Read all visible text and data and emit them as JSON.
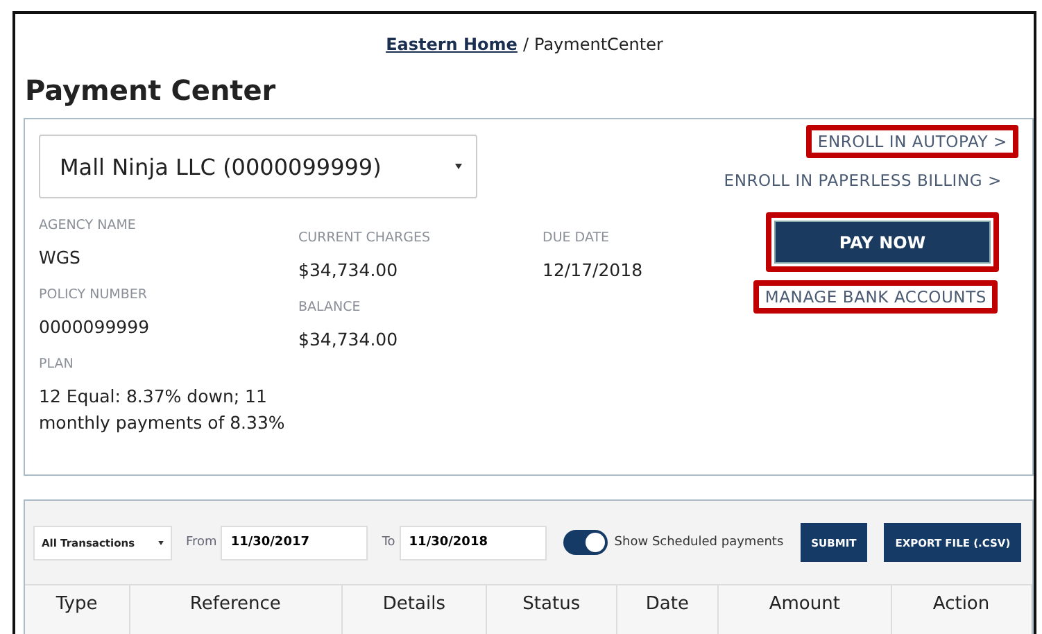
{
  "breadcrumb": {
    "link": "Eastern Home",
    "separator": "/",
    "current": "PaymentCenter"
  },
  "title": "Payment Center",
  "account": {
    "selector": {
      "value": "Mall Ninja LLC (0000099999)"
    },
    "fields": [
      [
        {
          "label": "AGENCY NAME",
          "value": "WGS"
        },
        {
          "label": "POLICY NUMBER",
          "value": "0000099999"
        },
        {
          "label": "PLAN",
          "value": "12 Equal: 8.37% down; 11 monthly payments of 8.33%"
        }
      ],
      [
        {
          "label": "CURRENT CHARGES",
          "value": "$34,734.00"
        },
        {
          "label": "BALANCE",
          "value": "$34,734.00"
        }
      ],
      [
        {
          "label": "DUE DATE",
          "value": "12/17/2018"
        }
      ]
    ],
    "actions": [
      {
        "kind": "link",
        "label": "ENROLL IN AUTOPAY >",
        "highlighted": true
      },
      {
        "kind": "link",
        "label": "ENROLL IN PAPERLESS BILLING >",
        "highlighted": false
      },
      {
        "kind": "button",
        "label": "PAY NOW",
        "highlighted": true
      },
      {
        "kind": "link",
        "label": "MANAGE BANK ACCOUNTS",
        "highlighted": true
      }
    ]
  },
  "filters": {
    "type_select": {
      "value": "All Transactions"
    },
    "from_label": "From",
    "from": "11/30/2017",
    "to_label": "To",
    "to": "11/30/2018",
    "toggle": {
      "label": "Show Scheduled payments",
      "on": true
    },
    "buttons": [
      "SUBMIT",
      "EXPORT FILE (.CSV)"
    ]
  },
  "table": {
    "columns": [
      "Type",
      "Reference",
      "Details",
      "Status",
      "Date",
      "Amount",
      "Action"
    ]
  }
}
